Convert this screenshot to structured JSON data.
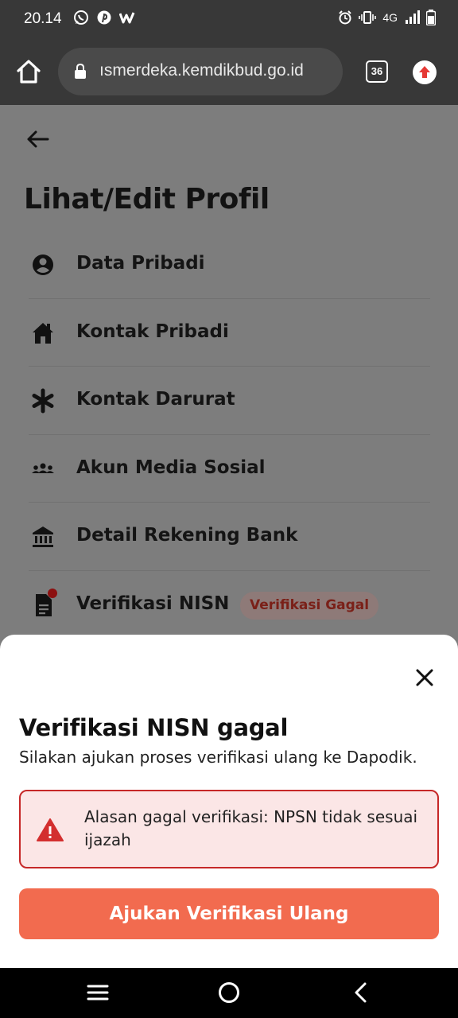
{
  "status_bar": {
    "time": "20.14",
    "network": "4G",
    "left_icons": [
      "whatsapp-icon",
      "pinterest-icon",
      "w-app-icon"
    ],
    "right_icons": [
      "alarm-icon",
      "vibrate-icon",
      "signal-icon",
      "battery-icon"
    ]
  },
  "browser": {
    "url": "ısmerdeka.kemdikbud.go.id",
    "tab_count": "36"
  },
  "page": {
    "title": "Lihat/Edit Profil",
    "menu": [
      {
        "label": "Data Pribadi",
        "icon": "user-circle-icon"
      },
      {
        "label": "Kontak Pribadi",
        "icon": "house-icon"
      },
      {
        "label": "Kontak Darurat",
        "icon": "asterisk-icon"
      },
      {
        "label": "Akun Media Sosial",
        "icon": "group-icon"
      },
      {
        "label": "Detail Rekening Bank",
        "icon": "bank-icon"
      },
      {
        "label": "Verifikasi NISN",
        "icon": "document-icon",
        "badge": "Verifikasi Gagal"
      }
    ]
  },
  "sheet": {
    "title": "Verifikasi NISN gagal",
    "subtitle": "Silakan ajukan proses verifikasi ulang ke Dapodik.",
    "alert_text": "Alasan gagal verifikasi: NPSN tidak sesuai ijazah",
    "button_label": "Ajukan Verifikasi Ulang"
  },
  "colors": {
    "accent": "#f26b4f",
    "alert_border": "#c62828",
    "alert_bg": "#fbe6e6",
    "overlay_bg": "#7d7d7d",
    "system_bar": "#383838"
  }
}
